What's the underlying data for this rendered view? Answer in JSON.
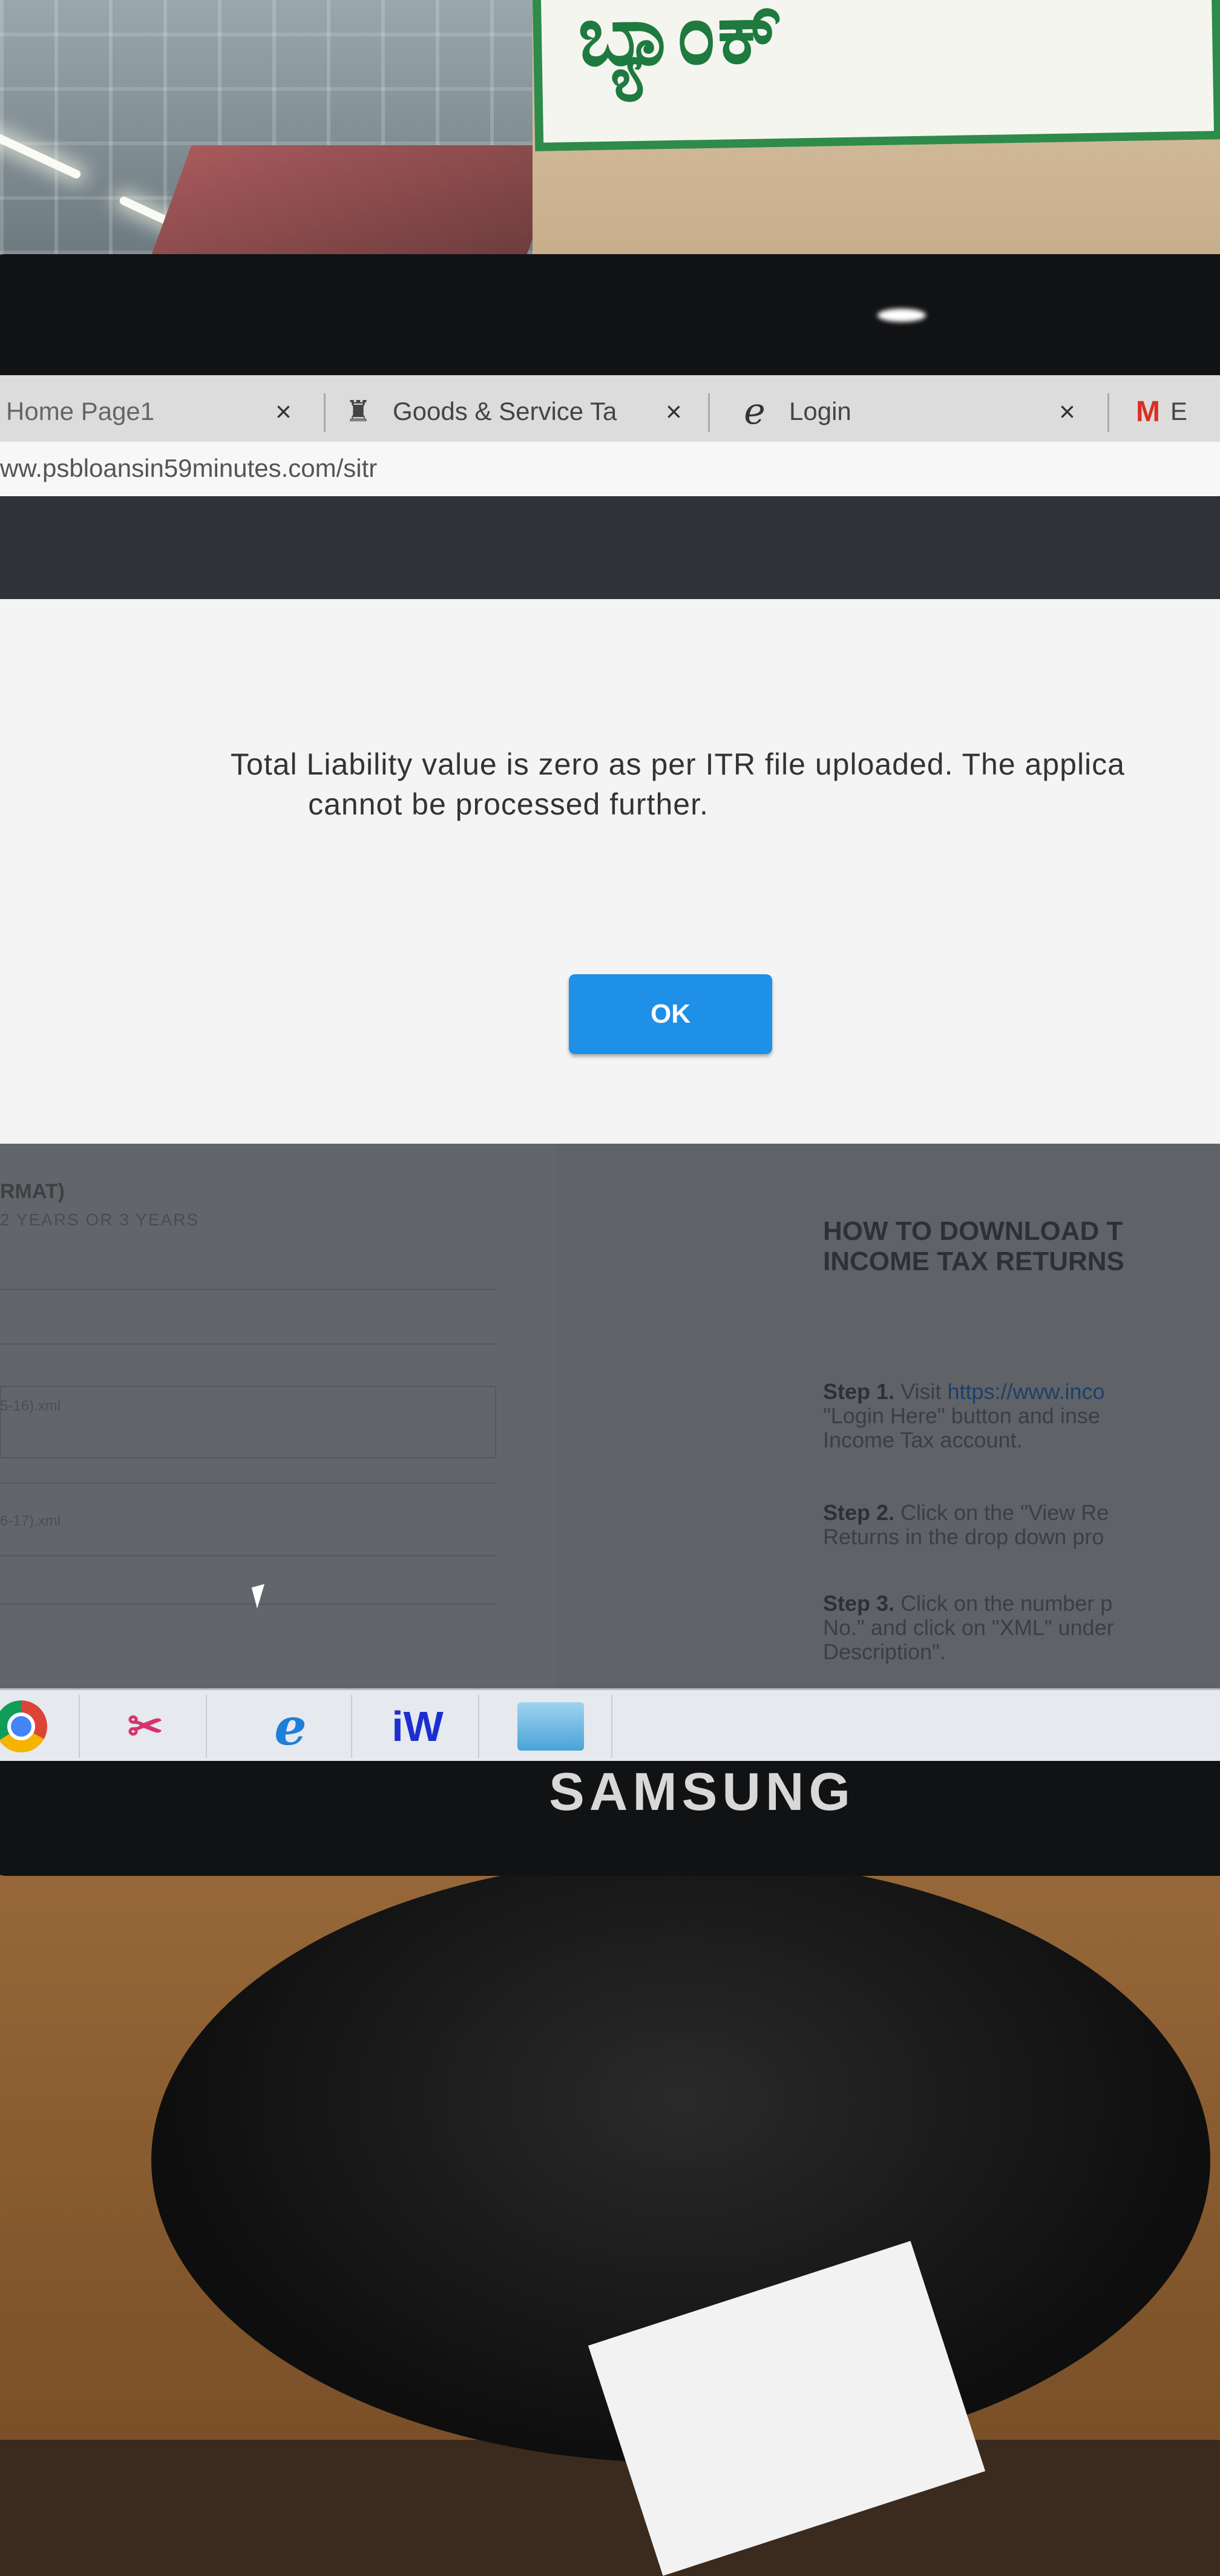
{
  "browser": {
    "tabs": [
      {
        "label": "Home Page1",
        "icon": "page-icon",
        "close": "×"
      },
      {
        "label": "Goods & Service Ta",
        "icon": "emblem-icon",
        "close": "×"
      },
      {
        "label": "Login",
        "icon": "ie-icon",
        "close": "×"
      },
      {
        "label": "E",
        "icon": "gmail-icon",
        "close": ""
      }
    ],
    "url": "ww.psbloansin59minutes.com/sitr"
  },
  "dialog": {
    "message_line1": "Total Liability value is zero as per ITR file uploaded. The applica",
    "message_line2": "cannot be processed further.",
    "ok_label": "OK",
    "ok_color": "#1e90e8"
  },
  "background_page": {
    "left_title": "RMAT)",
    "left_subtitle": "2 YEARS OR 3 YEARS",
    "file1": "5-16).xml",
    "file2": "6-17).xml",
    "how_title_line1": "HOW TO DOWNLOAD T",
    "how_title_line2": "INCOME TAX RETURNS",
    "step1_label": "Step 1.",
    "step1_text": "Visit",
    "step1_link": "https://www.inco",
    "step1_text2": "\"Login Here\" button and inse",
    "step1_text3": "Income Tax account.",
    "step2_label": "Step 2.",
    "step2_text": "Click on the \"View Re",
    "step2_text2": "Returns in the drop down pro",
    "step3_label": "Step 3.",
    "step3_text": "Click on the number p",
    "step3_text2": "No.\" and click on \"XML\" under",
    "step3_text3": "Description\"."
  },
  "taskbar": {
    "apps": [
      {
        "name": "chrome-icon"
      },
      {
        "name": "snipping-tool-icon"
      },
      {
        "name": "internet-explorer-icon"
      },
      {
        "name": "iw-app-icon",
        "label": "iW"
      },
      {
        "name": "control-panel-icon"
      }
    ]
  },
  "environment": {
    "brand": "SAMSUNG",
    "sign_text": "ಬ್ಯಾಂಕ್"
  }
}
